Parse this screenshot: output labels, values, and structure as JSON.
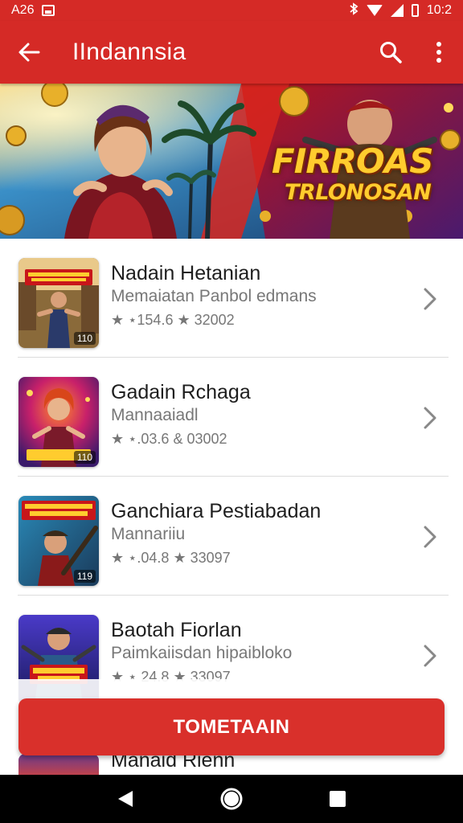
{
  "status_bar": {
    "left_text": "A26",
    "time": "10:2",
    "icons": [
      "image-icon",
      "bluetooth-icon",
      "wifi-icon",
      "signal-icon",
      "battery-icon"
    ]
  },
  "app_bar": {
    "title": "IIndannsia",
    "background": "#d52a26",
    "icons": [
      "back-arrow-icon",
      "search-icon",
      "more-vert-icon"
    ]
  },
  "banner": {
    "title": "FIRROAS",
    "subtitle": "TRLONOSAN"
  },
  "items": [
    {
      "title": "Nadain Hetanian",
      "subtitle": "Memaiatan Panbol edmans",
      "rating": "★ ⋆154.6 ★ 32002",
      "thumb_tag": "110",
      "thumb_text": ""
    },
    {
      "title": "Gadain Rchaga",
      "subtitle": "Mannaaiadl",
      "rating": "★ ⋆.03.6 & 03002",
      "thumb_tag": "110",
      "thumb_text": ""
    },
    {
      "title": "Ganchiara Pestiabadan",
      "subtitle": "Mannariiu",
      "rating": "★ ⋆.04.8 ★ 33097",
      "thumb_tag": "119",
      "thumb_text": ""
    },
    {
      "title": "Baotah Fiorlan",
      "subtitle": "Paimkaiisdan hipaibloko",
      "rating": "★ ⋆ 24.8 ★ 33097",
      "thumb_tag": "",
      "thumb_text": ""
    }
  ],
  "peek_item": {
    "title": "Manaid Rienn"
  },
  "cta": {
    "label": "TOMETAAIN",
    "color": "#d9302b"
  },
  "nav_bar": {
    "icons": [
      "back-triangle-icon",
      "home-circle-icon",
      "recents-square-icon"
    ]
  }
}
